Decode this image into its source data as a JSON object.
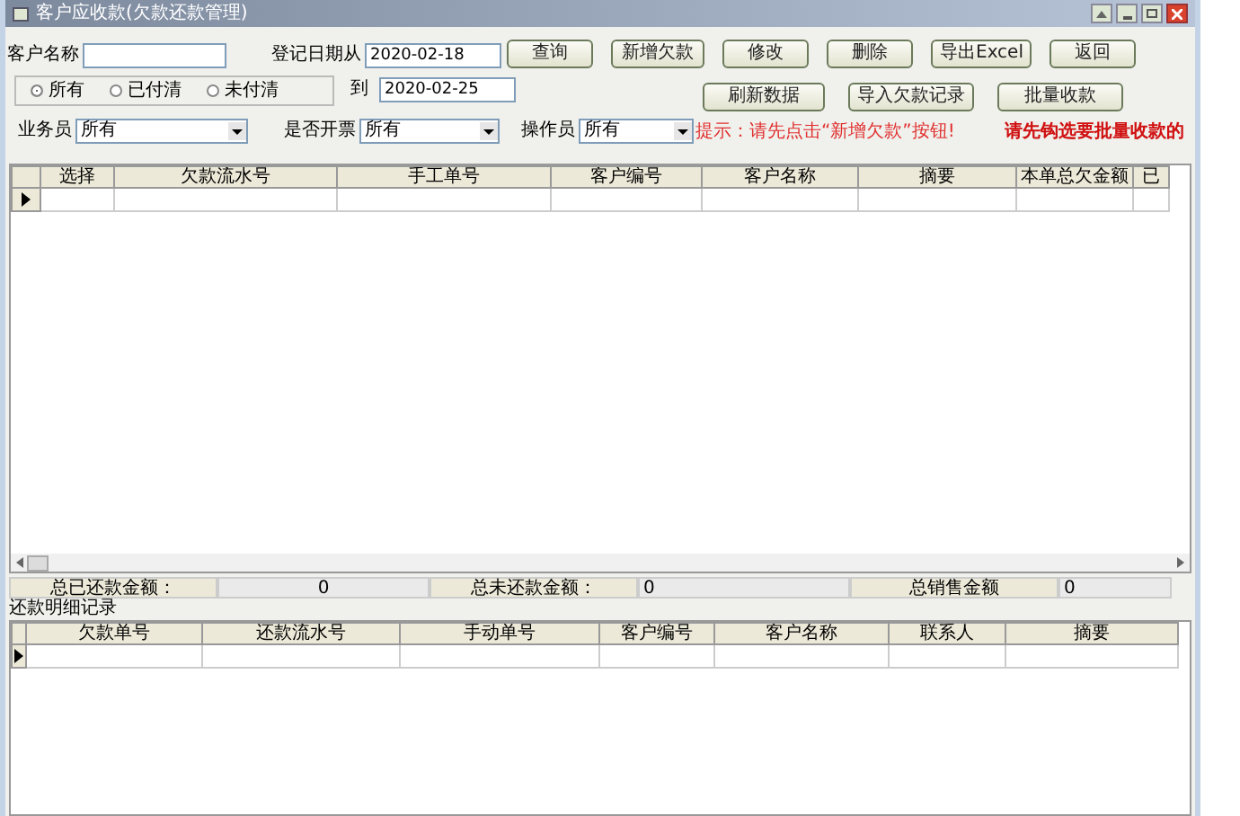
{
  "window": {
    "title": "客户应收款(欠款还款管理)"
  },
  "filters": {
    "customer_label": "客户名称",
    "date_from_label": "登记日期从",
    "date_from": "2020-02-18",
    "date_to_label": "到",
    "date_to": "2020-02-25",
    "status_options": [
      {
        "label": "所有",
        "selected": true
      },
      {
        "label": "已付清",
        "selected": false
      },
      {
        "label": "未付清",
        "selected": false
      }
    ],
    "dropdowns": [
      {
        "label": "业务员",
        "value": "所有"
      },
      {
        "label": "是否开票",
        "value": "所有"
      },
      {
        "label": "操作员",
        "value": "所有"
      }
    ]
  },
  "buttons_row1": [
    "查询",
    "新增欠款",
    "修改",
    "删除",
    "导出Excel",
    "返回"
  ],
  "buttons_row2": [
    "刷新数据",
    "导入欠款记录",
    "批量收款"
  ],
  "hint": "提示：请先点击“新增欠款”按钮!",
  "warning": "请先钩选要批量收款的",
  "table": {
    "columns": [
      "选择",
      "欠款流水号",
      "手工单号",
      "客户编号",
      "客户名称",
      "摘要",
      "本单总欠金额",
      "已"
    ]
  },
  "totals": [
    {
      "label": "总已还款金额：",
      "value": "0"
    },
    {
      "label": "总未还款金额：",
      "value": "0"
    },
    {
      "label": "总销售金额",
      "value": "0"
    }
  ],
  "detail": {
    "title": "还款明细记录",
    "columns": [
      "欠款单号",
      "还款流水号",
      "手动单号",
      "客户编号",
      "客户名称",
      "联系人",
      "摘要"
    ]
  }
}
